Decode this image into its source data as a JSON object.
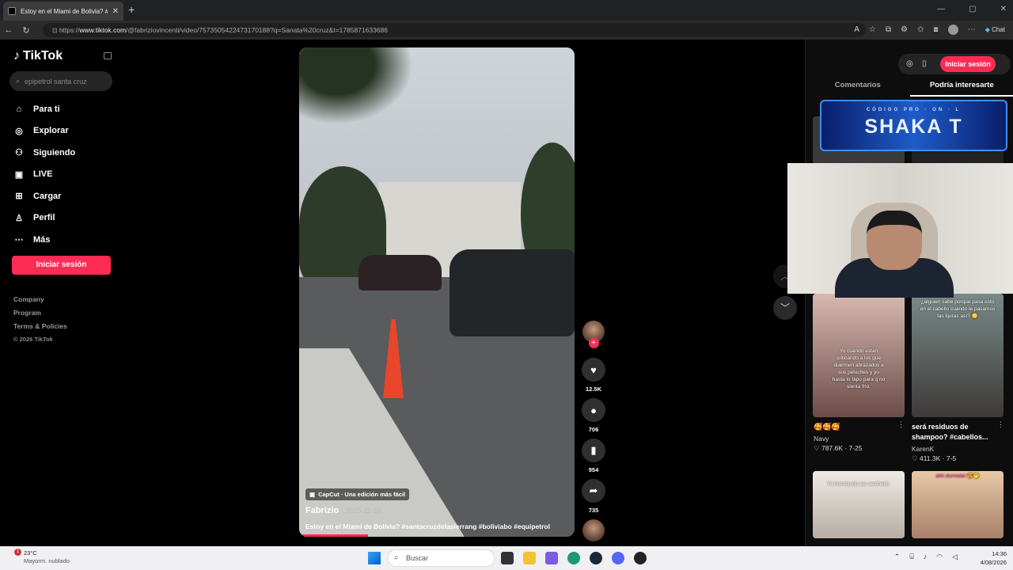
{
  "browser": {
    "tab_title": "Estoy en el Miami de Bolivia? #san",
    "tab_close": "✕",
    "new_tab": "+",
    "url_prefix": "https://",
    "url_host": "www.tiktok.com",
    "url_path": "/@fabriziovincenti/video/7573505422473170188?q=Sanata%20cruz&t=1785871633686",
    "chat_label": "Chat"
  },
  "sidebar": {
    "logo": "TikTok",
    "search_placeholder": "epipetrol santa cruz",
    "items": [
      {
        "label": "Para ti",
        "icon": "home-icon"
      },
      {
        "label": "Explorar",
        "icon": "compass-icon"
      },
      {
        "label": "Siguiendo",
        "icon": "following-icon"
      },
      {
        "label": "LIVE",
        "icon": "live-icon"
      },
      {
        "label": "Cargar",
        "icon": "upload-icon"
      },
      {
        "label": "Perfil",
        "icon": "profile-icon"
      },
      {
        "label": "Más",
        "icon": "more-icon"
      }
    ],
    "login_button": "Iniciar sesión",
    "footer": [
      "Company",
      "Program",
      "Terms & Policies"
    ],
    "copyright": "© 2026 TikTok"
  },
  "video": {
    "capcut_label": "CapCut · Una edición más fácil",
    "author": "Fabrizio",
    "date": "· 2025-11-16",
    "description": "Estoy en el Miami de Bolivia? #santacruzdelasierrang #boliviabo #equipetrol",
    "progress": 0.25
  },
  "actions": {
    "likes": "12.5K",
    "comments": "706",
    "saves": "954",
    "shares": "735"
  },
  "right_panel": {
    "login_button": "Iniciar sesión",
    "tabs": [
      "Comentarios",
      "Podría interesarte"
    ],
    "active_tab": 1,
    "banner_sub": "CÓDIGO PRO · ON · L",
    "banner_text": "SHAKA T",
    "cards": [
      {
        "caption": "🥰🥰🥰",
        "user": "Navy",
        "stats": "♡ 787.6K · 7-25",
        "overlay": "Yo cuando estan criticando a los que duermen abrazados a sus peluches y yo hasta lo tapo para q no sienta frio:"
      },
      {
        "caption": "será residuos de shampoo? #cabellos...",
        "user": "KarenK",
        "stats": "♡ 411.3K · 7-5",
        "overlay": "¿alguien sabe porque pasa esto en el cabello cuando le pasamos las tijeras así? 😳"
      },
      {
        "overlay": "Yo intentando ser aesthetic:"
      },
      {
        "overlay": "ahh dormidal 😍🤭"
      }
    ]
  },
  "taskbar": {
    "badge": "1",
    "temp": "23°C",
    "condition": "Mayorm. nublado",
    "search": "Buscar",
    "time": "14:36",
    "date": "4/08/2026"
  }
}
